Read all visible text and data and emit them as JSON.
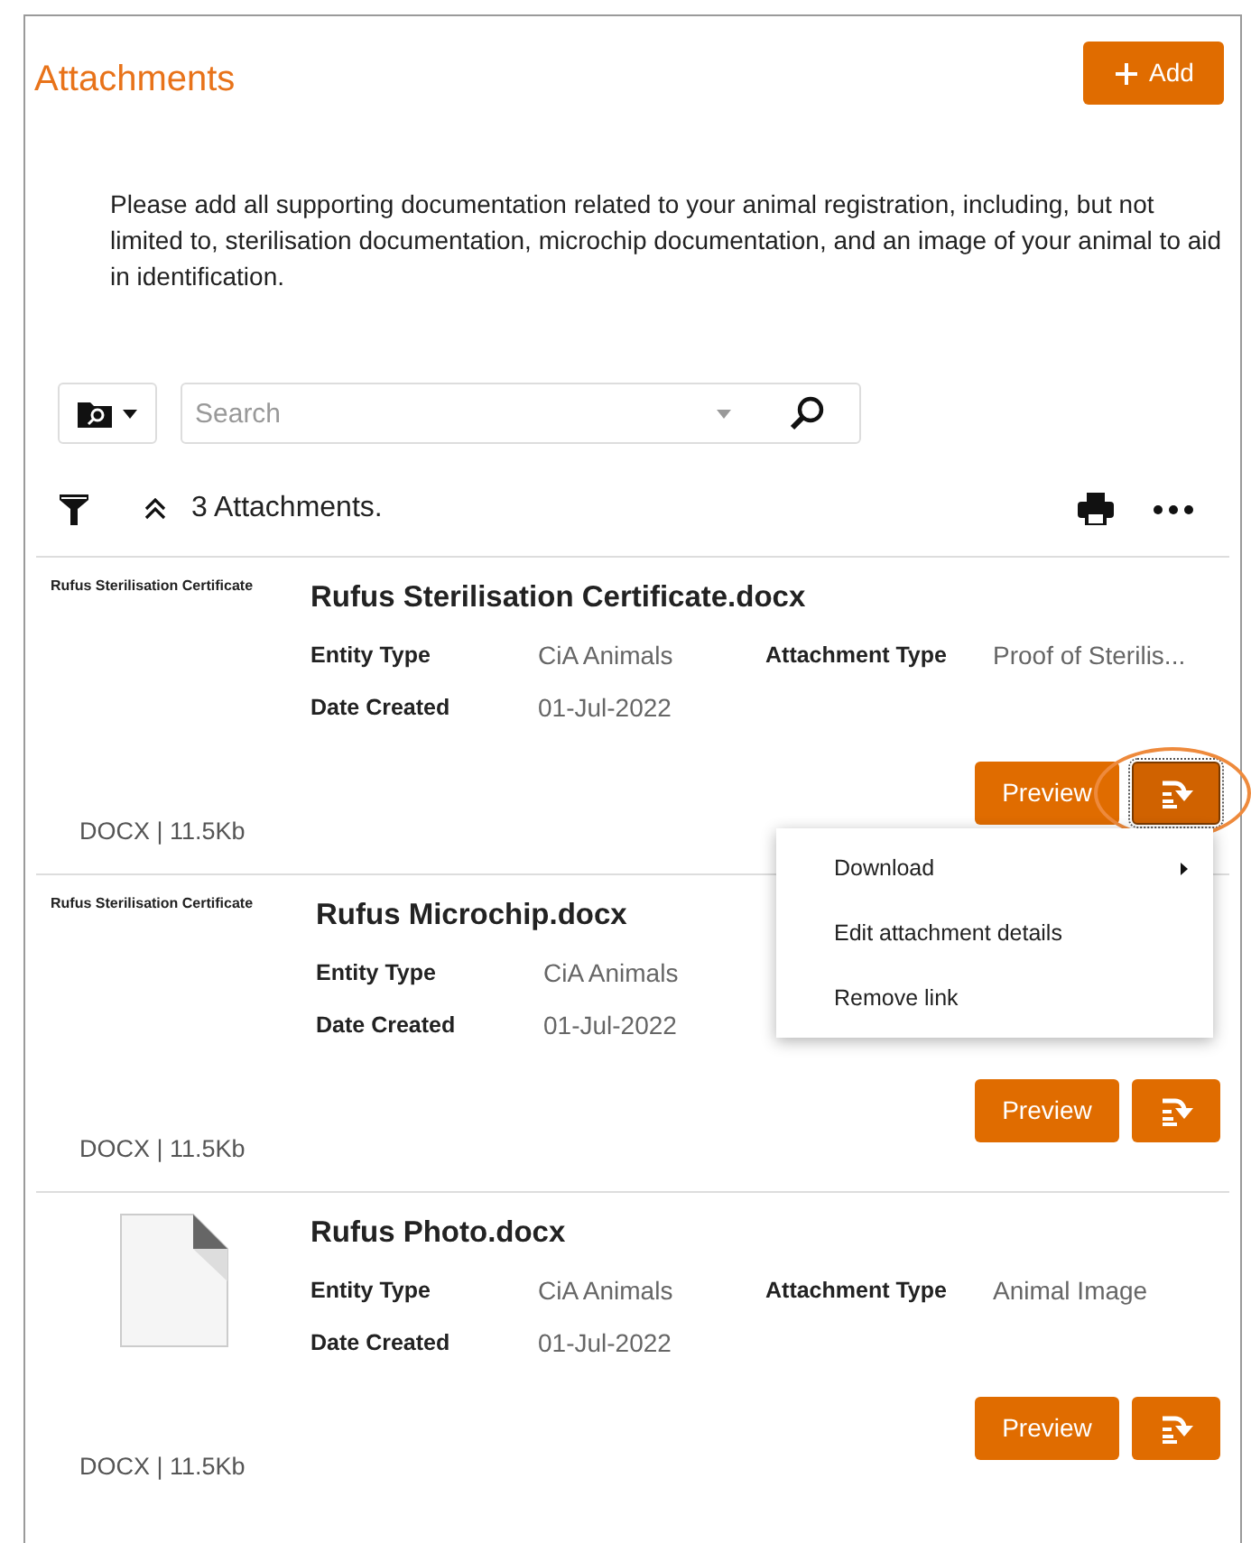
{
  "header": {
    "title": "Attachments",
    "add_label": "Add"
  },
  "description": "Please add all supporting documentation related to your animal registration, including, but not limited to, sterilisation documentation, microchip documentation, and an image of your animal to aid in identification.",
  "search": {
    "placeholder": "Search"
  },
  "summary": "3 Attachments.",
  "attachments": [
    {
      "thumbnail": {
        "kind": "preview",
        "text": "Rufus Sterilisation Certificate"
      },
      "title": "Rufus Sterilisation Certificate.docx",
      "rows": [
        [
          {
            "label": "Entity Type",
            "value": "CiA Animals"
          },
          {
            "label": "Attachment Type",
            "value": "Proof of Sterilis..."
          }
        ],
        [
          {
            "label": "Date Created",
            "value": "01-Jul-2022"
          }
        ]
      ],
      "file_info": "DOCX | 11.5Kb",
      "preview_label": "Preview",
      "highlighted": true
    },
    {
      "thumbnail": {
        "kind": "preview",
        "text": "Rufus Sterilisation Certificate"
      },
      "title": "Rufus Microchip.docx",
      "rows": [
        [
          {
            "label": "Entity Type",
            "value": "CiA Animals"
          }
        ],
        [
          {
            "label": "Date Created",
            "value": "01-Jul-2022"
          }
        ]
      ],
      "file_info": "DOCX | 11.5Kb",
      "preview_label": "Preview",
      "highlighted": false
    },
    {
      "thumbnail": {
        "kind": "file"
      },
      "title": "Rufus Photo.docx",
      "rows": [
        [
          {
            "label": "Entity Type",
            "value": "CiA Animals"
          },
          {
            "label": "Attachment Type",
            "value": "Animal Image"
          }
        ],
        [
          {
            "label": "Date Created",
            "value": "01-Jul-2022"
          }
        ]
      ],
      "file_info": "DOCX | 11.5Kb",
      "preview_label": "Preview",
      "highlighted": false
    }
  ],
  "context_menu": {
    "items": [
      {
        "label": "Download",
        "has_submenu": true
      },
      {
        "label": "Edit attachment details",
        "has_submenu": false
      },
      {
        "label": "Remove link",
        "has_submenu": false
      }
    ]
  }
}
